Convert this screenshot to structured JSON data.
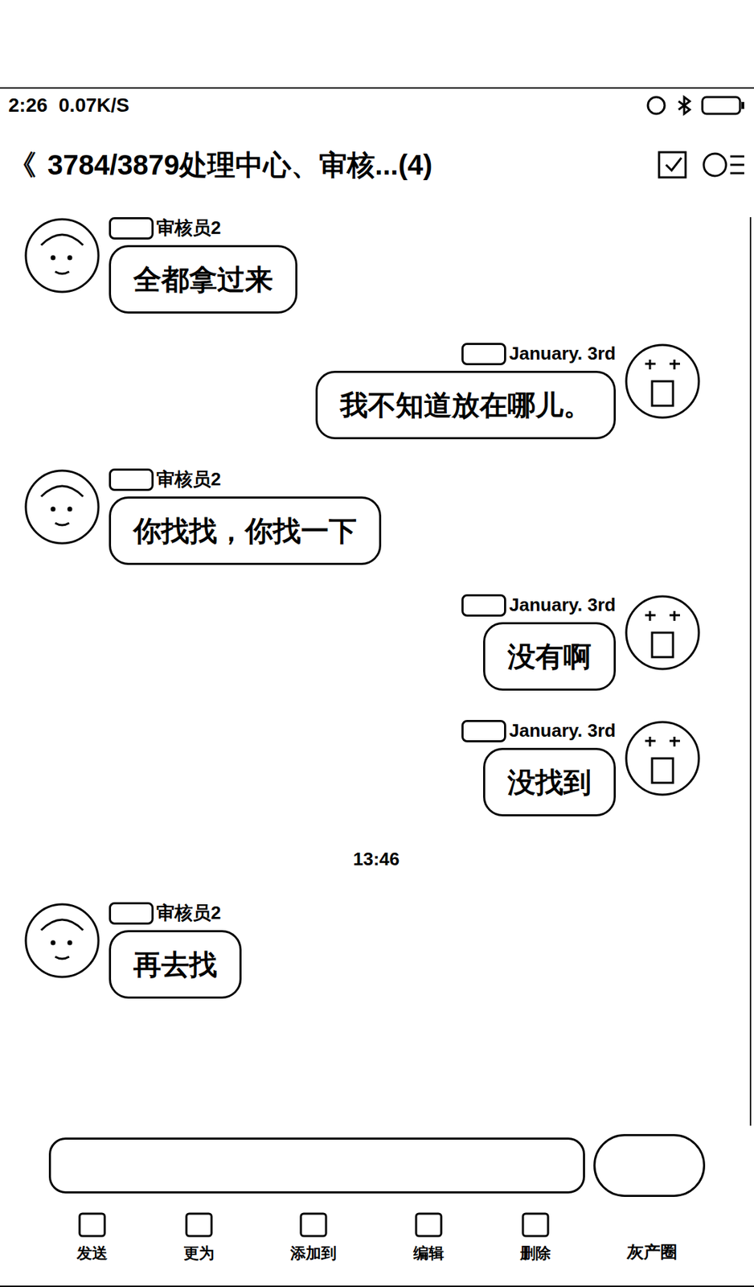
{
  "status_bar": {
    "time": "2:26",
    "speed": "0.07K/S"
  },
  "header": {
    "back": "《",
    "title": "3784/3879处理中心、审核...(4)"
  },
  "messages": [
    {
      "kind": "incoming",
      "sender": "审核员2",
      "text": "全都拿过来"
    },
    {
      "kind": "outgoing",
      "sender": "January. 3rd",
      "text": "我不知道放在哪儿。"
    },
    {
      "kind": "incoming",
      "sender": "审核员2",
      "text": "你找找，你找一下"
    },
    {
      "kind": "outgoing",
      "sender": "January. 3rd",
      "text": "没有啊"
    },
    {
      "kind": "outgoing",
      "sender": "January. 3rd",
      "text": "没找到"
    },
    {
      "kind": "time",
      "sender": "",
      "text": "13:46"
    },
    {
      "kind": "incoming",
      "sender": "审核员2",
      "text": "再去找"
    }
  ],
  "toolbar": [
    "发送",
    "更为",
    "添加到",
    "编辑",
    "删除"
  ],
  "watermark": "灰产圈"
}
